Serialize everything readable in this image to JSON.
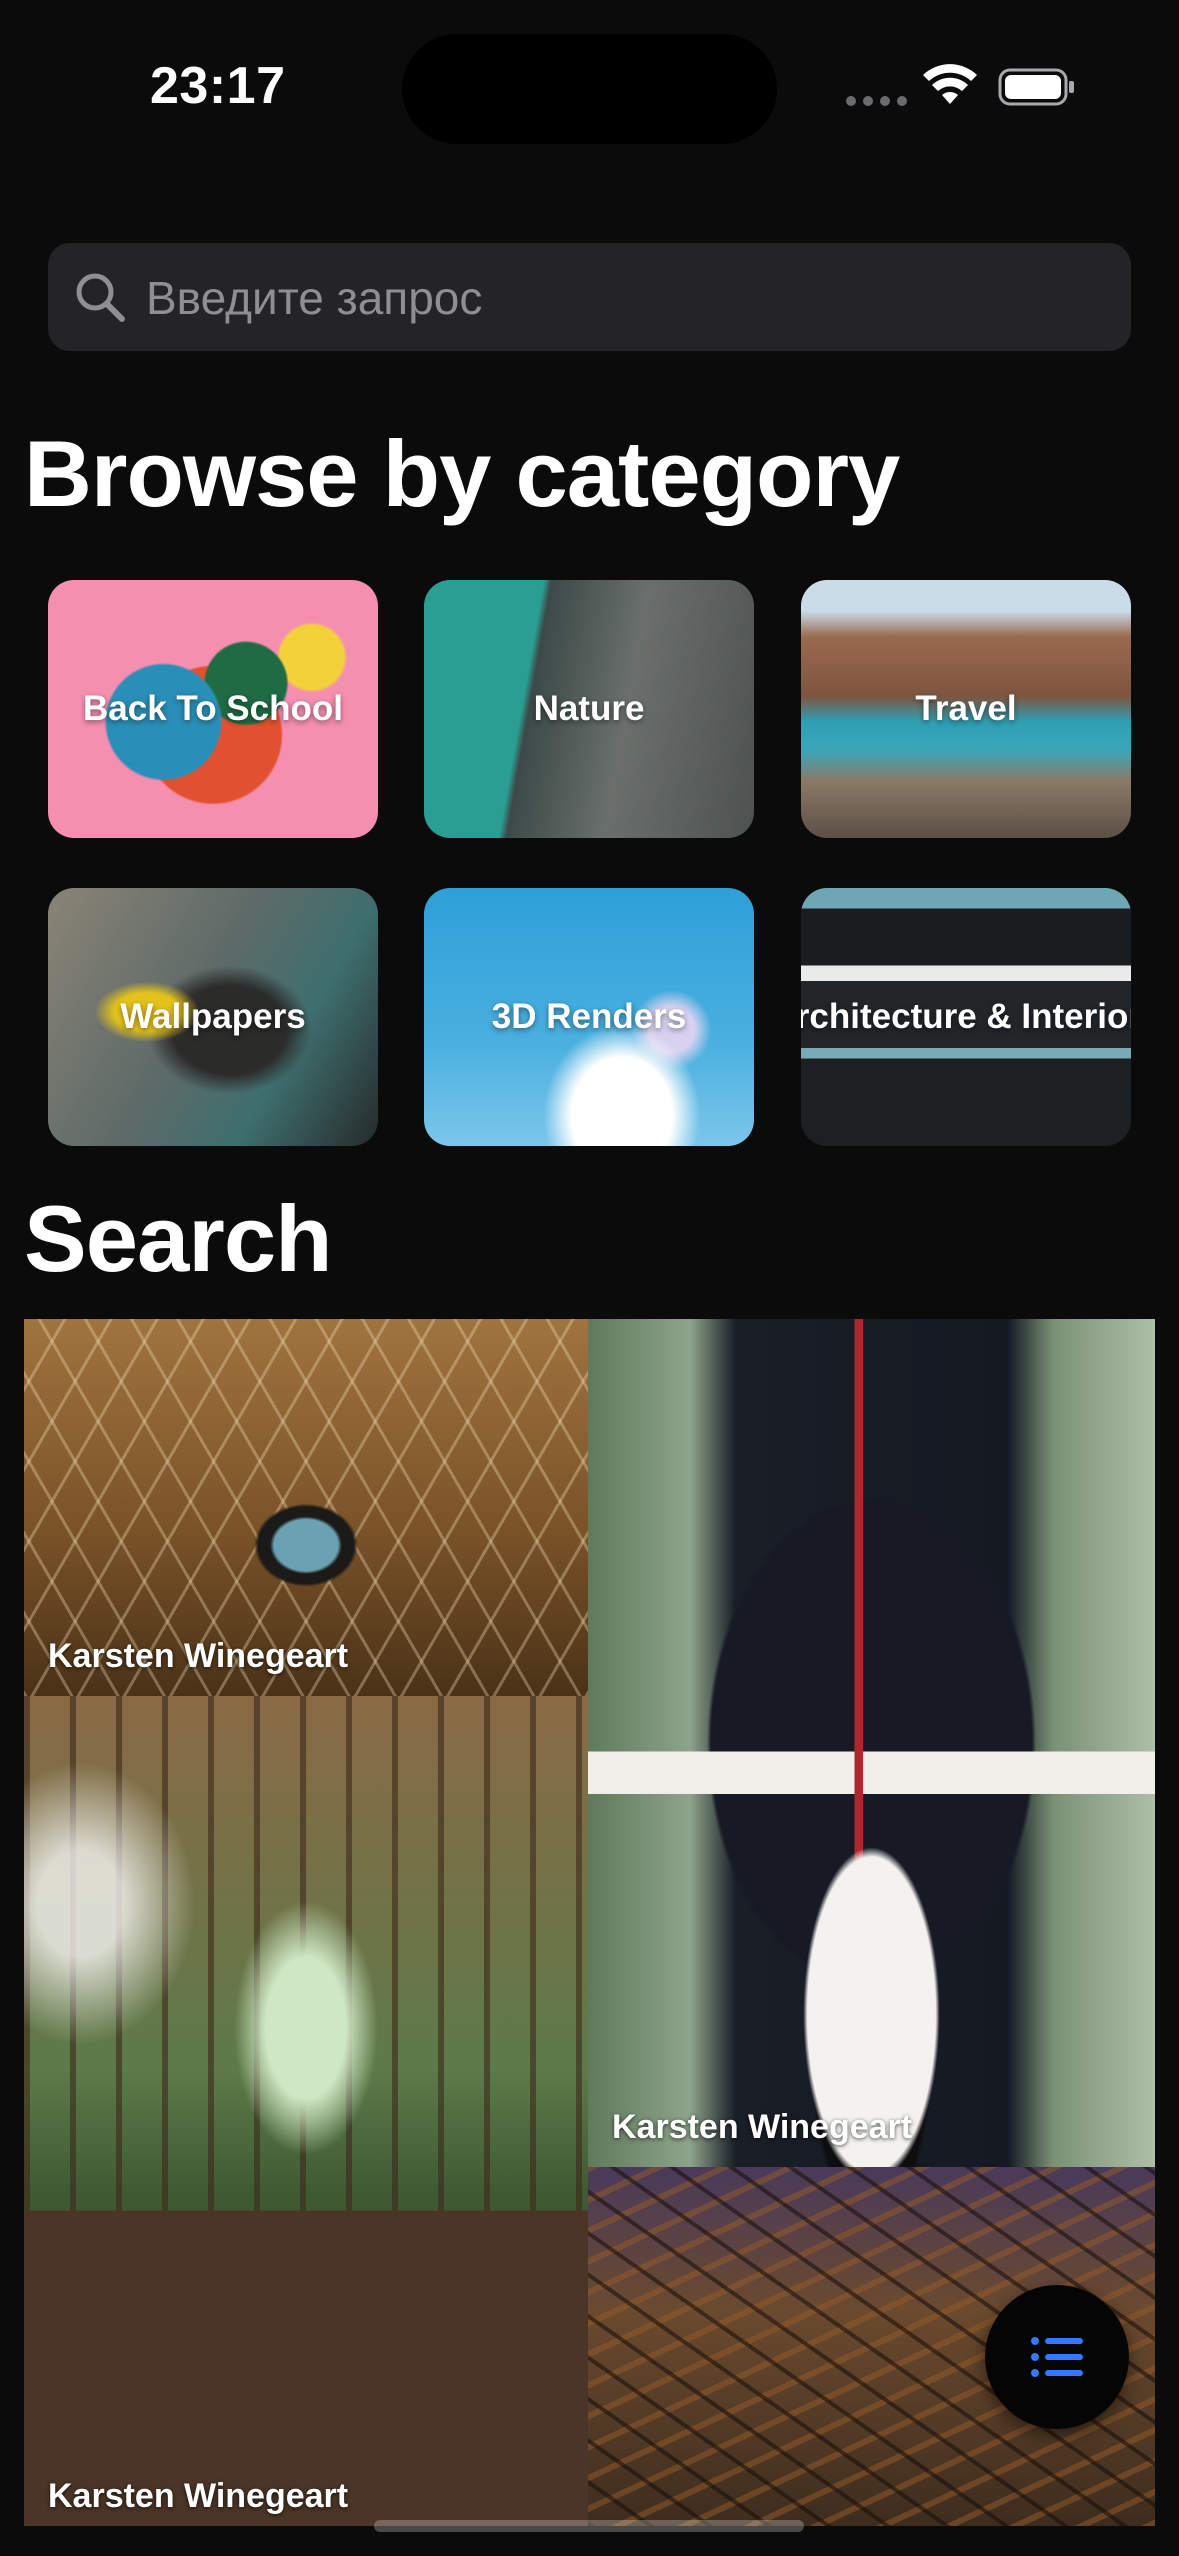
{
  "status_bar": {
    "time": "23:17",
    "icons": [
      "cellular-icon",
      "wifi-icon",
      "battery-icon"
    ]
  },
  "search": {
    "placeholder": "Введите запрос",
    "value": ""
  },
  "browse": {
    "title": "Browse by category",
    "categories": [
      {
        "label": "Back To School"
      },
      {
        "label": "Nature"
      },
      {
        "label": "Travel"
      },
      {
        "label": "Wallpapers"
      },
      {
        "label": "3D Renders"
      },
      {
        "label": "Architecture & Interiors"
      }
    ]
  },
  "results": {
    "title": "Search",
    "photos": [
      {
        "author": "Karsten Winegeart"
      },
      {
        "author": "Karsten Winegeart"
      },
      {
        "author": "Karsten Winegeart"
      },
      {
        "author": ""
      }
    ]
  },
  "fab": {
    "icon": "list-icon"
  },
  "colors": {
    "background": "#0b0b0c",
    "search_field": "#242426",
    "placeholder": "#8e8e93",
    "accent": "#2f7cf6"
  }
}
